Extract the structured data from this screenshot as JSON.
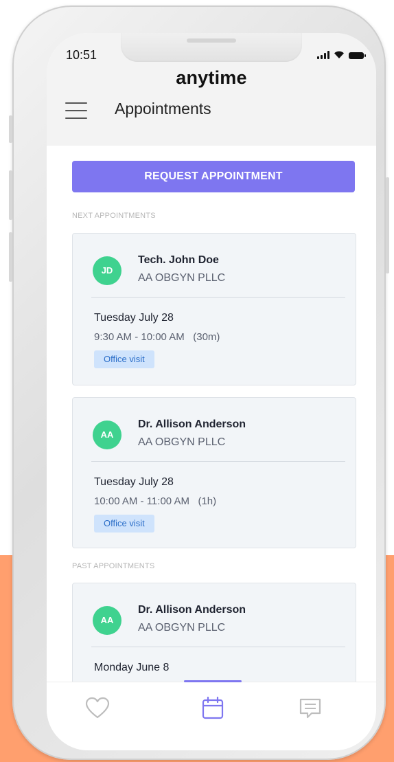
{
  "status_bar": {
    "time": "10:51"
  },
  "header": {
    "brand": "anytime",
    "title": "Appointments"
  },
  "request_button": {
    "label": "REQUEST APPOINTMENT"
  },
  "sections": {
    "next_label": "NEXT APPOINTMENTS",
    "past_label": "PAST APPOINTMENTS"
  },
  "appointments": [
    {
      "initials": "JD",
      "provider": "Tech. John Doe",
      "practice": "AA OBGYN PLLC",
      "date": "Tuesday July 28",
      "time": "9:30 AM - 10:00 AM   (30m)",
      "type": "Office visit"
    },
    {
      "initials": "AA",
      "provider": "Dr. Allison Anderson",
      "practice": "AA OBGYN PLLC",
      "date": "Tuesday July 28",
      "time": "10:00 AM - 11:00 AM   (1h)",
      "type": "Office visit"
    },
    {
      "initials": "AA",
      "provider": "Dr. Allison Anderson",
      "practice": "AA OBGYN PLLC",
      "date": "Monday June 8"
    }
  ],
  "tabs": [
    {
      "icon": "heart-icon"
    },
    {
      "icon": "calendar-icon",
      "active": true
    },
    {
      "icon": "message-icon"
    }
  ],
  "colors": {
    "accent": "#7e76f0",
    "avatar": "#3fd28f",
    "badge_bg": "#cfe3fc",
    "badge_text": "#2b6ec8",
    "background_orange": "#ff9f6e"
  }
}
